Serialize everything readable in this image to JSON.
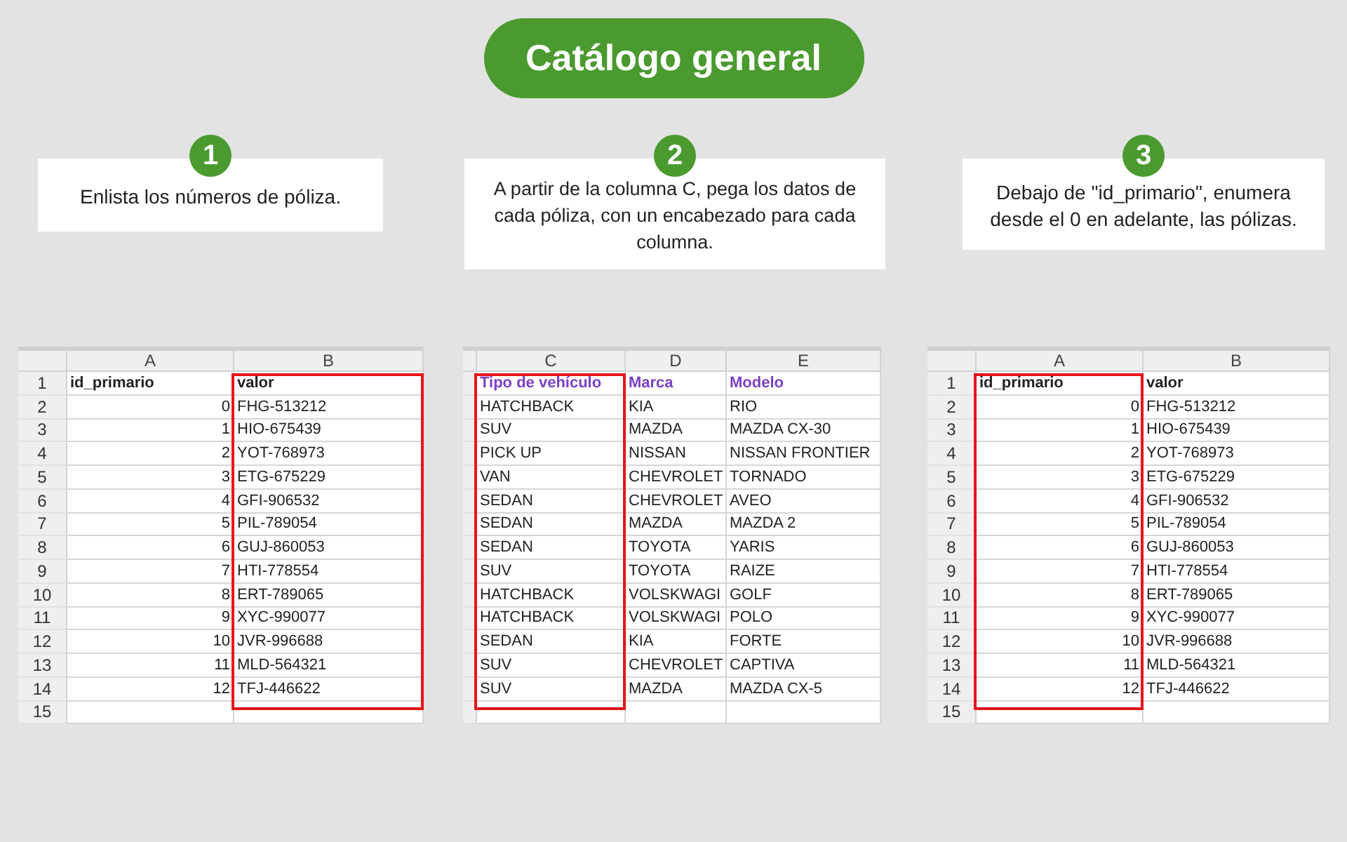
{
  "title": "Catálogo general",
  "steps": [
    {
      "number": "1",
      "text": "Enlista los números de póliza."
    },
    {
      "number": "2",
      "text": "A partir de la columna C, pega los datos de cada póliza, con un encabezado para cada columna."
    },
    {
      "number": "3",
      "text": "Debajo de \"id_primario\", enumera desde el 0 en adelante, las pólizas."
    }
  ],
  "sheets": [
    {
      "row_numbers": [
        "1",
        "2",
        "3",
        "4",
        "5",
        "6",
        "7",
        "8",
        "9",
        "10",
        "11",
        "12",
        "13",
        "14",
        "15"
      ],
      "columns": [
        {
          "letter": "A",
          "kind": "number",
          "highlighted": false
        },
        {
          "letter": "B",
          "kind": "text",
          "highlighted": true
        }
      ],
      "header": {
        "color": "#222222",
        "cells": [
          "id_primario",
          "valor"
        ]
      },
      "rows": [
        [
          "0",
          "FHG-513212"
        ],
        [
          "1",
          "HIO-675439"
        ],
        [
          "2",
          "YOT-768973"
        ],
        [
          "3",
          "ETG-675229"
        ],
        [
          "4",
          "GFI-906532"
        ],
        [
          "5",
          "PIL-789054"
        ],
        [
          "6",
          "GUJ-860053"
        ],
        [
          "7",
          "HTI-778554"
        ],
        [
          "8",
          "ERT-789065"
        ],
        [
          "9",
          "XYC-990077"
        ],
        [
          "10",
          "JVR-996688"
        ],
        [
          "11",
          "MLD-564321"
        ],
        [
          "12",
          "TFJ-446622"
        ]
      ]
    },
    {
      "columns": [
        {
          "letter": "C",
          "kind": "text",
          "highlighted": true
        },
        {
          "letter": "D",
          "kind": "text",
          "highlighted": false
        },
        {
          "letter": "E",
          "kind": "text",
          "highlighted": false
        }
      ],
      "header": {
        "color": "#7b3fc4",
        "cells": [
          "Tipo de vehículo",
          "Marca",
          "Modelo"
        ]
      },
      "rows": [
        [
          "HATCHBACK",
          "KIA",
          "RIO"
        ],
        [
          "SUV",
          "MAZDA",
          "MAZDA CX-30"
        ],
        [
          "PICK UP",
          "NISSAN",
          "NISSAN FRONTIER"
        ],
        [
          "VAN",
          "CHEVROLET",
          "TORNADO"
        ],
        [
          "SEDAN",
          "CHEVROLET",
          "AVEO"
        ],
        [
          "SEDAN",
          "MAZDA",
          "MAZDA 2"
        ],
        [
          "SEDAN",
          "TOYOTA",
          "YARIS"
        ],
        [
          "SUV",
          "TOYOTA",
          "RAIZE"
        ],
        [
          "HATCHBACK",
          "VOLSKWAGI",
          "GOLF"
        ],
        [
          "HATCHBACK",
          "VOLSKWAGI",
          "POLO"
        ],
        [
          "SEDAN",
          "KIA",
          "FORTE"
        ],
        [
          "SUV",
          "CHEVROLET",
          "CAPTIVA"
        ],
        [
          "SUV",
          "MAZDA",
          "MAZDA CX-5"
        ]
      ]
    },
    {
      "row_numbers": [
        "1",
        "2",
        "3",
        "4",
        "5",
        "6",
        "7",
        "8",
        "9",
        "10",
        "11",
        "12",
        "13",
        "14",
        "15"
      ],
      "columns": [
        {
          "letter": "A",
          "kind": "number",
          "highlighted": true
        },
        {
          "letter": "B",
          "kind": "text",
          "highlighted": false
        }
      ],
      "header": {
        "color": "#222222",
        "cells": [
          "id_primario",
          "valor"
        ]
      },
      "rows": [
        [
          "0",
          "FHG-513212"
        ],
        [
          "1",
          "HIO-675439"
        ],
        [
          "2",
          "YOT-768973"
        ],
        [
          "3",
          "ETG-675229"
        ],
        [
          "4",
          "GFI-906532"
        ],
        [
          "5",
          "PIL-789054"
        ],
        [
          "6",
          "GUJ-860053"
        ],
        [
          "7",
          "HTI-778554"
        ],
        [
          "8",
          "ERT-789065"
        ],
        [
          "9",
          "XYC-990077"
        ],
        [
          "10",
          "JVR-996688"
        ],
        [
          "11",
          "MLD-564321"
        ],
        [
          "12",
          "TFJ-446622"
        ]
      ]
    }
  ]
}
